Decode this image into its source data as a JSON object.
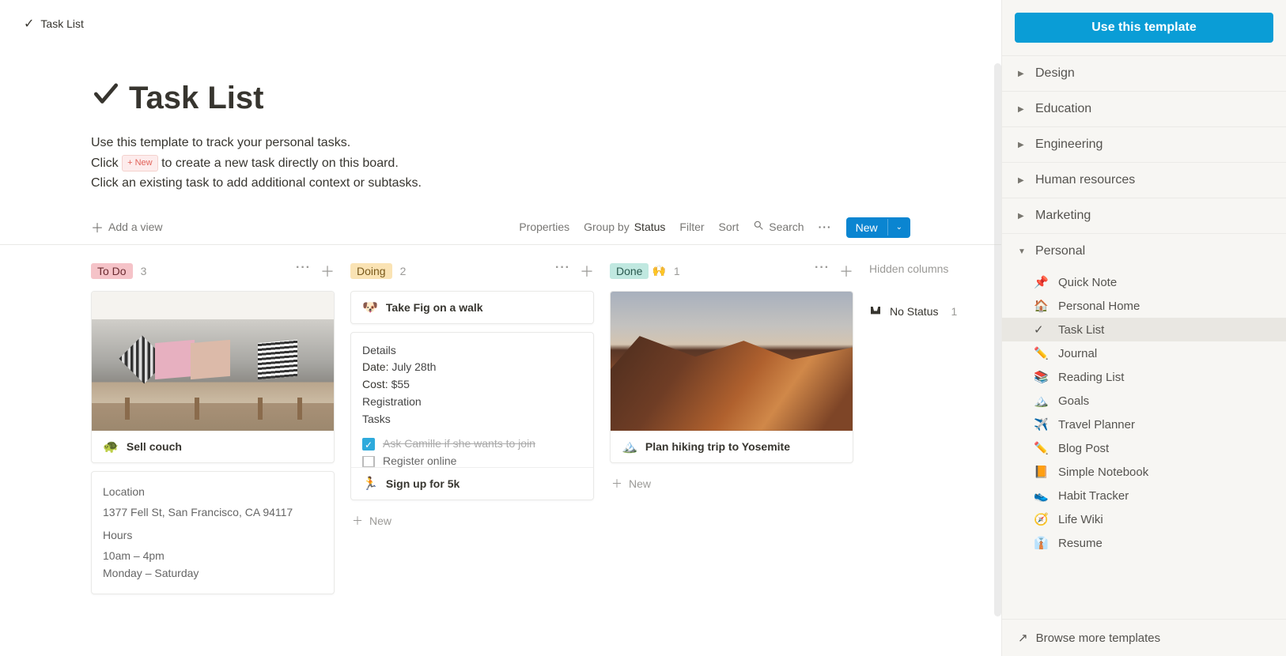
{
  "breadcrumb": {
    "icon": "✓",
    "label": "Task List"
  },
  "header": {
    "icon": "✓",
    "title": "Task List",
    "desc_line1": "Use this template to track your personal tasks.",
    "desc_line2a": "Click ",
    "desc_line2_pill": "+ New",
    "desc_line2b": " to create a new task directly on this board.",
    "desc_line3": "Click an existing task to add additional context or subtasks."
  },
  "toolbar": {
    "add_view": "Add a view",
    "properties": "Properties",
    "group_by": "Group by",
    "group_by_val": "Status",
    "filter": "Filter",
    "sort": "Sort",
    "search": "Search",
    "new_label": "New"
  },
  "board": {
    "hidden_label": "Hidden columns",
    "no_status": {
      "label": "No Status",
      "count": "1"
    },
    "columns": [
      {
        "name": "To Do",
        "count": "3",
        "tag_class": "tag-todo",
        "cards": [
          {
            "type": "cover-card",
            "cover": "couch",
            "emoji": "🐢",
            "title": "Sell couch"
          },
          {
            "type": "detail-card",
            "heading": "Location",
            "line1": "1377 Fell St, San Francisco, CA 94117",
            "heading2": "Hours",
            "line3": "10am – 4pm",
            "line4": "Monday – Saturday"
          }
        ],
        "show_add_new": false
      },
      {
        "name": "Doing",
        "count": "2",
        "tag_class": "tag-doing",
        "cards": [
          {
            "type": "simple",
            "emoji": "🐶",
            "title": "Take Fig on a walk"
          },
          {
            "type": "detail-card2",
            "heading": "Details",
            "date_label": "Date:",
            "date_val": " July 28th",
            "cost_label": "Cost:",
            "cost_val": " $55",
            "reg": "Registration",
            "tasks_label": "Tasks",
            "task1": "Ask Camille if she wants to join",
            "task2": "Register online",
            "footer_emoji": "🏃",
            "footer_title": "Sign up for 5k"
          }
        ],
        "add_new_label": "New",
        "show_add_new": true
      },
      {
        "name": "Done",
        "name_emoji": "🙌",
        "count": "1",
        "tag_class": "tag-done",
        "cards": [
          {
            "type": "cover-card",
            "cover": "mountain",
            "emoji": "🏔️",
            "title": "Plan hiking trip to Yosemite"
          }
        ],
        "add_new_label": "New",
        "show_add_new": true
      }
    ]
  },
  "sidebar": {
    "cta": "Use this template",
    "categories": [
      {
        "label": "Design",
        "expanded": false
      },
      {
        "label": "Education",
        "expanded": false
      },
      {
        "label": "Engineering",
        "expanded": false
      },
      {
        "label": "Human resources",
        "expanded": false
      },
      {
        "label": "Marketing",
        "expanded": false
      },
      {
        "label": "Personal",
        "expanded": true,
        "children": [
          {
            "emoji": "📌",
            "label": "Quick Note"
          },
          {
            "emoji": "🏠",
            "label": "Personal Home"
          },
          {
            "emoji": "✓",
            "label": "Task List",
            "active": true
          },
          {
            "emoji": "✏️",
            "label": "Journal"
          },
          {
            "emoji": "📚",
            "label": "Reading List"
          },
          {
            "emoji": "🏔️",
            "label": "Goals"
          },
          {
            "emoji": "✈️",
            "label": "Travel Planner"
          },
          {
            "emoji": "✏️",
            "label": "Blog Post"
          },
          {
            "emoji": "📙",
            "label": "Simple Notebook"
          },
          {
            "emoji": "👟",
            "label": "Habit Tracker"
          },
          {
            "emoji": "🧭",
            "label": "Life Wiki"
          },
          {
            "emoji": "👔",
            "label": "Resume"
          }
        ]
      }
    ],
    "browse_more": "Browse more templates"
  }
}
